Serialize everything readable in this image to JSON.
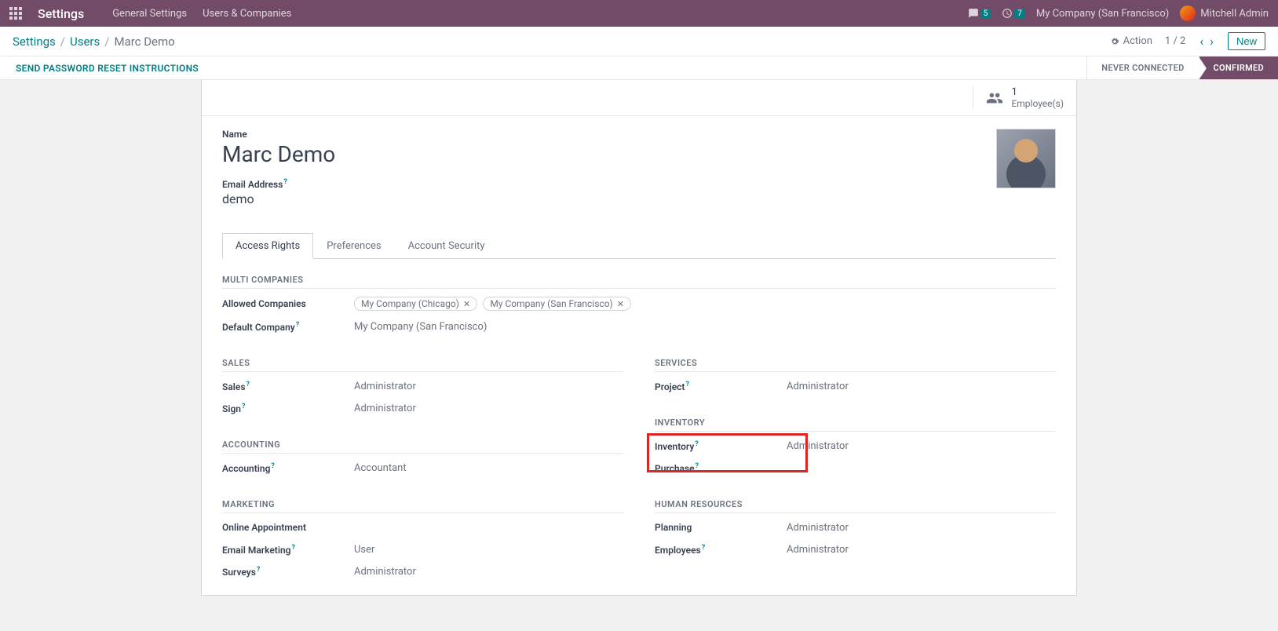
{
  "topbar": {
    "title": "Settings",
    "menu": [
      "General Settings",
      "Users & Companies"
    ],
    "messages_badge": "5",
    "activities_badge": "7",
    "company": "My Company (San Francisco)",
    "user": "Mitchell Admin"
  },
  "breadcrumb": {
    "items": [
      "Settings",
      "Users"
    ],
    "current": "Marc Demo"
  },
  "subbar": {
    "action": "Action",
    "pager": "1 / 2",
    "new_btn": "New"
  },
  "statusbar": {
    "action": "SEND PASSWORD RESET INSTRUCTIONS",
    "steps": [
      "NEVER CONNECTED",
      "CONFIRMED"
    ]
  },
  "employee_btn": {
    "count": "1",
    "label": "Employee(s)"
  },
  "form": {
    "name_label": "Name",
    "name_value": "Marc Demo",
    "email_label": "Email Address",
    "email_value": "demo",
    "tabs": [
      "Access Rights",
      "Preferences",
      "Account Security"
    ]
  },
  "sections": {
    "multi_companies": {
      "title": "MULTI COMPANIES",
      "allowed_label": "Allowed Companies",
      "allowed_tags": [
        "My Company (Chicago)",
        "My Company (San Francisco)"
      ],
      "default_label": "Default Company",
      "default_value": "My Company (San Francisco)"
    },
    "sales": {
      "title": "SALES",
      "rows": [
        {
          "label": "Sales",
          "value": "Administrator"
        },
        {
          "label": "Sign",
          "value": "Administrator"
        }
      ]
    },
    "services": {
      "title": "SERVICES",
      "rows": [
        {
          "label": "Project",
          "value": "Administrator"
        }
      ]
    },
    "accounting": {
      "title": "ACCOUNTING",
      "rows": [
        {
          "label": "Accounting",
          "value": "Accountant"
        }
      ]
    },
    "inventory": {
      "title": "INVENTORY",
      "rows": [
        {
          "label": "Inventory",
          "value": "Administrator"
        },
        {
          "label": "Purchase",
          "value": ""
        }
      ]
    },
    "marketing": {
      "title": "MARKETING",
      "rows": [
        {
          "label": "Online Appointment",
          "value": ""
        },
        {
          "label": "Email Marketing",
          "value": "User"
        },
        {
          "label": "Surveys",
          "value": "Administrator"
        }
      ]
    },
    "hr": {
      "title": "HUMAN RESOURCES",
      "rows": [
        {
          "label": "Planning",
          "value": "Administrator"
        },
        {
          "label": "Employees",
          "value": "Administrator"
        }
      ]
    }
  }
}
